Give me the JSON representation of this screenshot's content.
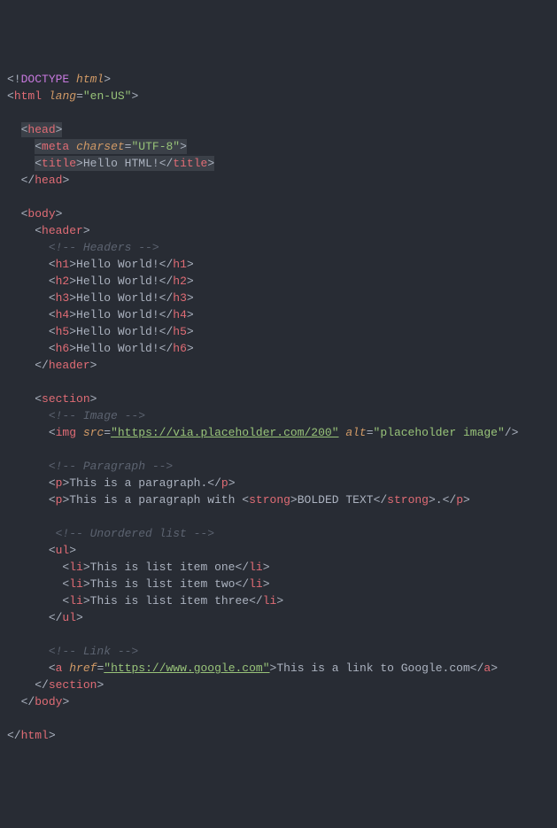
{
  "lines": {
    "l1_doctype": "DOCTYPE",
    "l1_html": "html",
    "l2_html": "html",
    "l2_attr": "lang",
    "l2_val": "\"en-US\"",
    "l4_head": "head",
    "l5_meta": "meta",
    "l5_attr": "charset",
    "l5_val": "\"UTF-8\"",
    "l6_title": "title",
    "l6_text": "Hello HTML!",
    "l7_head": "head",
    "l9_body": "body",
    "l10_header": "header",
    "l11_comment": "<!-- Headers -->",
    "l12_tag": "h1",
    "l12_text": "Hello World!",
    "l13_tag": "h2",
    "l13_text": "Hello World!",
    "l14_tag": "h3",
    "l14_text": "Hello World!",
    "l15_tag": "h4",
    "l15_text": "Hello World!",
    "l16_tag": "h5",
    "l16_text": "Hello World!",
    "l17_tag": "h6",
    "l17_text": "Hello World!",
    "l18_header": "header",
    "l20_section": "section",
    "l21_comment": "<!-- Image -->",
    "l22_img": "img",
    "l22_src": "src",
    "l22_srcval": "\"https://via.placeholder.com/200\"",
    "l22_alt": "alt",
    "l22_altval": "\"placeholder image\"",
    "l24_comment": "<!-- Paragraph -->",
    "l25_p": "p",
    "l25_text": "This is a paragraph.",
    "l26_p": "p",
    "l26_text1": "This is a paragraph with ",
    "l26_strong": "strong",
    "l26_bold": "BOLDED TEXT",
    "l26_text2": ".",
    "l28_comment": "<!-- Unordered list -->",
    "l29_ul": "ul",
    "l30_li": "li",
    "l30_text": "This is list item one",
    "l31_li": "li",
    "l31_text": "This is list item two",
    "l32_li": "li",
    "l32_text": "This is list item three",
    "l33_ul": "ul",
    "l35_comment": "<!-- Link -->",
    "l36_a": "a",
    "l36_href": "href",
    "l36_hrefval": "\"https://www.google.com\"",
    "l36_text": "This is a link to Google.com",
    "l37_section": "section",
    "l38_body": "body",
    "l40_html": "html"
  }
}
